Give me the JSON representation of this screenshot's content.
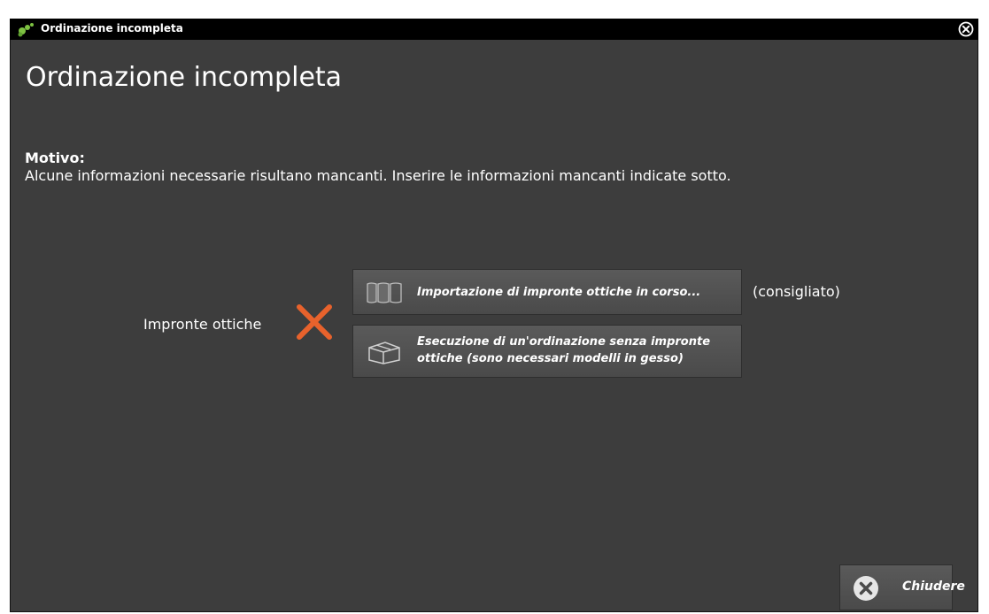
{
  "window": {
    "title": "Ordinazione incompleta"
  },
  "main": {
    "heading": "Ordinazione incompleta",
    "reason_label": "Motivo:",
    "reason_text": "Alcune informazioni necessarie risultano mancanti. Inserire le informazioni mancanti indicate sotto."
  },
  "missing_item": {
    "label": "Impronte ottiche",
    "status_icon": "x-mark-icon",
    "status_color": "#e8622c"
  },
  "actions": {
    "import_label": "Importazione di impronte ottiche in corso...",
    "import_icon": "optical-impression-icon",
    "recommended_label": "(consigliato)",
    "no_impression_line1": "Esecuzione di un'ordinazione senza impronte",
    "no_impression_line2": "ottiche (sono necessari modelli in gesso)",
    "no_impression_icon": "box-icon"
  },
  "footer": {
    "close_label": "Chiudere",
    "close_icon": "close-circle-icon"
  },
  "colors": {
    "background": "#3d3d3d",
    "titlebar": "#000000",
    "accent_green": "#7ec242",
    "error_orange": "#e8622c"
  }
}
